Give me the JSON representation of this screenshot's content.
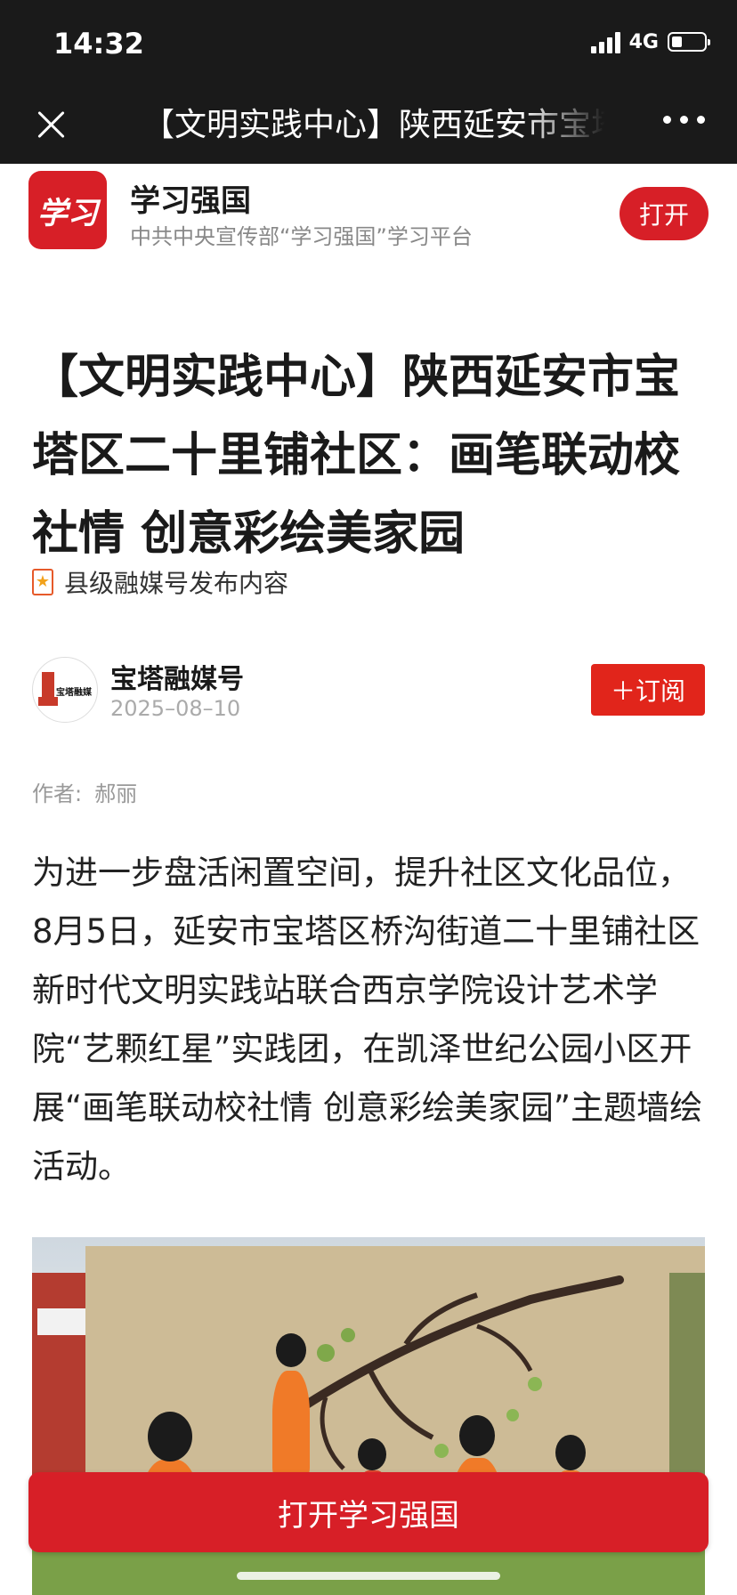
{
  "status_bar": {
    "time": "14:32",
    "network": "4G"
  },
  "nav": {
    "title": "【文明实践中心】陕西延安市宝塔区二十里铺社区：画笔联动校社情 创意彩绘美家园"
  },
  "app_banner": {
    "logo_text": "学习",
    "name": "学习强国",
    "description": "中共中央宣传部“学习强国”学习平台",
    "open_label": "打开"
  },
  "article": {
    "headline": "【文明实践中心】陕西延安市宝塔区二十里铺社区：画笔联动校社情 创意彩绘美家园",
    "source_note": "县级融媒号发布内容",
    "author": {
      "avatar_text": "宝塔融媒",
      "name": "宝塔融媒号",
      "date": "2025–08–10",
      "subscribe_label": "＋订阅"
    },
    "byline": {
      "label": "作者:",
      "name": "郝丽"
    },
    "body": "为进一步盘活闲置空间，提升社区文化品位，8月5日，延安市宝塔区桥沟街道二十里铺社区新时代文明实践站联合西京学院设计艺术学院“艺颗红星”实践团，在凯泽世纪公园小区开展“画笔联动校社情 创意彩绘美家园”主题墙绘活动。"
  },
  "cta": {
    "label": "打开学习强国"
  },
  "colors": {
    "brand_red": "#d71f27",
    "subscribe_red": "#e1251b",
    "dark_bar": "#1a1a1a"
  }
}
